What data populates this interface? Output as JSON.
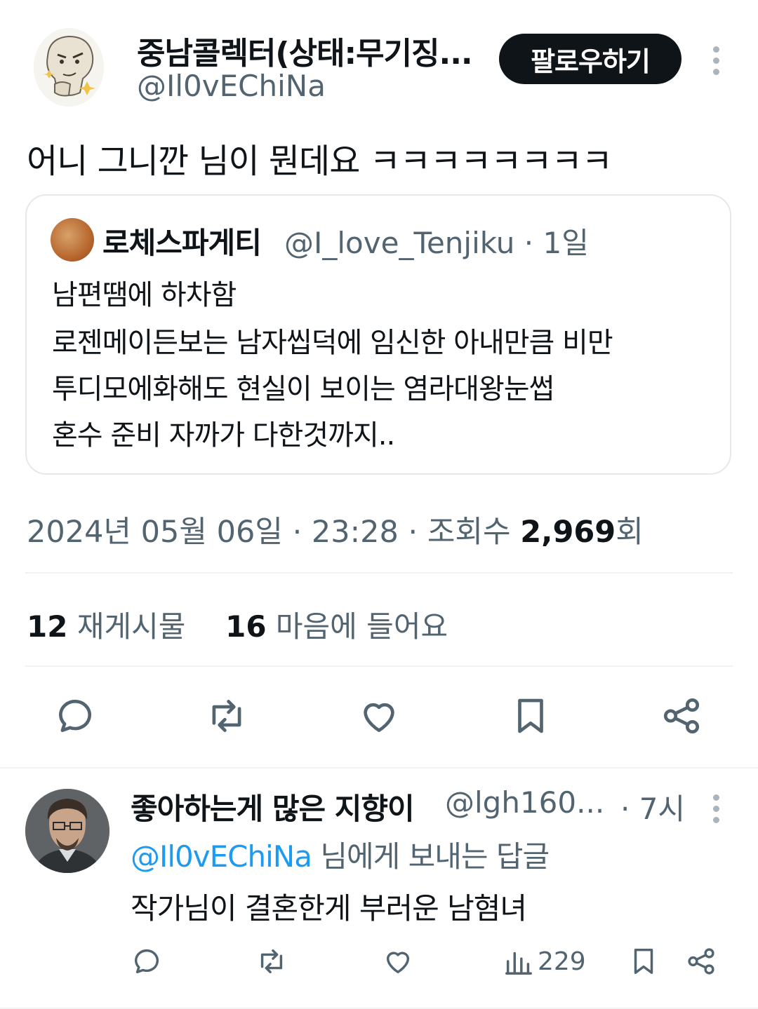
{
  "tweet": {
    "author_name": "중남콜렉터(상태:무기징...",
    "author_handle": "@Il0vEChiNa",
    "follow_label": "팔로우하기",
    "text": "어니 그니깐 님이 뭔데요 ㅋㅋㅋㅋㅋㅋㅋㅋ",
    "date": "2024년 05월 06일",
    "time": "23:28",
    "views_label": "조회수",
    "views_count": "2,969",
    "views_suffix": "회",
    "reposts_count": "12",
    "reposts_label": "재게시물",
    "likes_count": "16",
    "likes_label": "마음에 들어요"
  },
  "quote": {
    "author_name": "로체스파게티",
    "author_handle": "@I_love_Tenjiku",
    "time_ago": "· 1일",
    "lines": [
      "남편땜에 하차함",
      "로젠메이든보는 남자씹덕에 임신한 아내만큼 비만",
      "투디모에화해도 현실이 보이는 염라대왕눈썹",
      "혼수 준비 자까가 다한것까지.."
    ]
  },
  "actions": [
    "reply-icon",
    "repost-icon",
    "like-icon",
    "bookmark-icon",
    "share-icon"
  ],
  "reply": {
    "author_name": "좋아하는게 많은 지향이",
    "author_handle": "@lgh160...",
    "time_ago": "· 7시",
    "replying_to": "@Il0vEChiNa",
    "replying_suffix": "님에게 보내는 답글",
    "text": "작가님이 결혼한게 부러운 남혐녀",
    "views": "229"
  },
  "colors": {
    "text": "#0f1419",
    "secondary": "#536471",
    "accent": "#1d9bf0",
    "border": "#e4e9ed"
  }
}
